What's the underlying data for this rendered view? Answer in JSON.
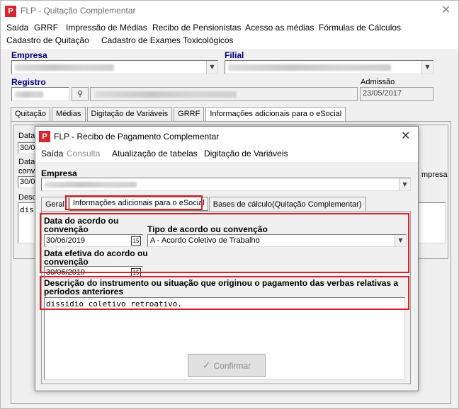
{
  "main": {
    "title": "FLP - Quitação Complementar",
    "icon_letter": "P",
    "menu": [
      "Saída",
      "GRRF",
      "Impressão de Médias",
      "Recibo de Pensionistas",
      "Acesso as médias",
      "Fórmulas de Cálculos",
      "Cadastro de Quitação",
      "Cadastro de Exames Toxicológicos"
    ],
    "empresa_label": "Empresa",
    "filial_label": "Filial",
    "registro_label": "Registro",
    "admissao_label": "Admissão",
    "admissao_value": "23/05/2017",
    "tabs": [
      "Quitação",
      "Médias",
      "Digitação de Variáveis",
      "GRRF",
      "Informações adicionais para o eSocial"
    ],
    "behind_labels": {
      "data1": "Data",
      "date1": "30/0",
      "data2": "Data",
      "conv": "conv",
      "date2": "30/0",
      "desc": "Desc",
      "disc": "diss",
      "mpresa": "mpresa"
    }
  },
  "dialog": {
    "title": "FLP - Recibo de Pagamento Complementar",
    "icon_letter": "P",
    "menu": [
      {
        "label": "Saída",
        "enabled": true
      },
      {
        "label": "Consulta",
        "enabled": false
      },
      {
        "label": "Atualização de tabelas",
        "enabled": true
      },
      {
        "label": "Digitação de Variáveis",
        "enabled": true
      }
    ],
    "empresa_label": "Empresa",
    "tabs": [
      "Geral",
      "Informações adicionais para o eSocial",
      "Bases de cálculo(Quitação Complementar)"
    ],
    "data_acordo_label_1": "Data do acordo ou",
    "data_acordo_label_2": "convenção",
    "data_acordo_value": "30/06/2019",
    "tipo_acordo_label": "Tipo de acordo ou convenção",
    "tipo_acordo_value": "A - Acordo Coletivo de Trabalho",
    "data_efetiva_label_1": "Data efetiva do acordo ou",
    "data_efetiva_label_2": "convenção",
    "data_efetiva_value": "30/06/2019",
    "descricao_label_1": "Descrição do instrumento ou situação que originou o pagamento das verbas relativas a",
    "descricao_label_2": "períodos anteriores",
    "descricao_value": "dissidio coletivo retroativo.",
    "confirm_label": "Confirmar",
    "calendar_glyph": "15"
  }
}
